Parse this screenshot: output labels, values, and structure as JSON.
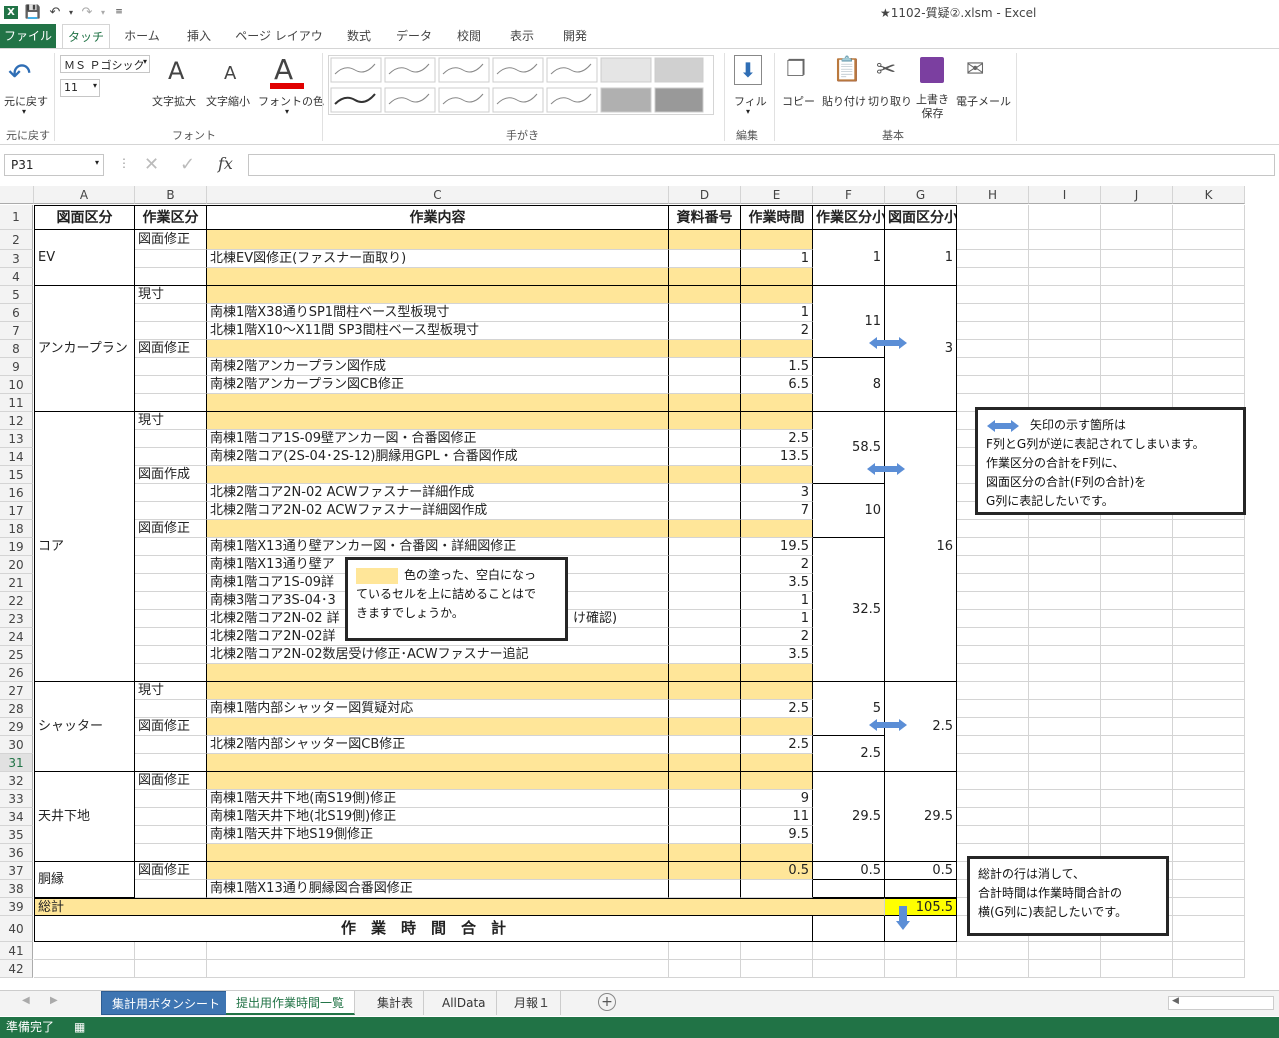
{
  "window": {
    "title": "★1102-質疑②.xlsm - Excel"
  },
  "ribbon": {
    "tabs": [
      "ファイル",
      "タッチ",
      "ホーム",
      "挿入",
      "ページ レイアウト",
      "数式",
      "データ",
      "校閲",
      "表示",
      "開発"
    ],
    "undo_label": "元に戻す",
    "undo_group": "元に戻す",
    "font_name": "ＭＳ Ｐゴシック",
    "font_size": "11",
    "grow_label": "文字拡大",
    "shrink_label": "文字縮小",
    "fontcolor_label": "フォントの色",
    "font_group": "フォント",
    "ink_group": "手がき",
    "fill_label": "フィル",
    "edit_group": "編集",
    "copy_label": "コピー",
    "paste_label": "貼り付け",
    "cut_label": "切り取り",
    "save_label": "上書き\n保存",
    "email_label": "電子メール",
    "basic_group": "基本",
    "accent": "#217346"
  },
  "formula_bar": {
    "namebox": "P31",
    "fx": "fx",
    "value": ""
  },
  "columns": [
    "A",
    "B",
    "C",
    "D",
    "E",
    "F",
    "G",
    "H",
    "I",
    "J",
    "K"
  ],
  "rows": [
    "1",
    "2",
    "3",
    "4",
    "5",
    "6",
    "7",
    "8",
    "9",
    "10",
    "11",
    "12",
    "13",
    "14",
    "15",
    "16",
    "17",
    "18",
    "19",
    "20",
    "21",
    "22",
    "23",
    "24",
    "25",
    "26",
    "27",
    "28",
    "29",
    "30",
    "31",
    "32",
    "33",
    "34",
    "35",
    "36",
    "37",
    "38",
    "39",
    "40",
    "41",
    "42"
  ],
  "sheet": {
    "headers": {
      "a": "図面区分",
      "b": "作業区分",
      "c": "作業内容",
      "d": "資料番号",
      "e": "作業時間",
      "f": "作業区分小計",
      "g": "図面区分小計"
    },
    "labels": {
      "ev": "EV",
      "anchor": "アンカープラン",
      "core": "コア",
      "shutter": "シャッター",
      "ceiling": "天井下地",
      "dobuchi": "胴縁",
      "total": "総計",
      "total_hours": "作　業　時　間　合　計"
    },
    "cells": {
      "b2": "図面修正",
      "c3": "北棟EV図修正(ファスナー面取り)",
      "e3": "1",
      "f3": "1",
      "g3": "1",
      "b5": "現寸",
      "c6": "南棟1階X38通りSP1間柱ベース型板現寸",
      "e6": "1",
      "c7": "北棟1階X10～X11間 SP3間柱ベース型板現寸",
      "e7": "2",
      "f7": "11",
      "b8": "図面修正",
      "g8": "3",
      "c9": "南棟2階アンカープラン図作成",
      "e9": "1.5",
      "c10": "南棟2階アンカープラン図CB修正",
      "e10": "6.5",
      "f10": "8",
      "b12": "現寸",
      "c13": "南棟1階コア1S-09壁アンカー図・合番図修正",
      "e13": "2.5",
      "c14": "南棟2階コア(2S-04･2S-12)胴縁用GPL・合番図作成",
      "e14": "13.5",
      "f14": "58.5",
      "b15": "図面作成",
      "c16": "北棟2階コア2N-02 ACWファスナー詳細作成",
      "e16": "3",
      "c17": "北棟2階コア2N-02 ACWファスナー詳細図作成",
      "e17": "7",
      "f17": "10",
      "b18": "図面修正",
      "c19": "南棟1階X13通り壁アンカー図・合番図・詳細図修正",
      "e19": "19.5",
      "g19": "16",
      "c20": "南棟1階X13通り壁ア",
      "e20": "2",
      "c21": "南棟1階コア1S-09詳",
      "e21": "3.5",
      "c22": "南棟3階コア3S-04･3",
      "e22": "1",
      "f22": "32.5",
      "c23": "北棟2階コア2N-02 詳",
      "c23b": "け確認)",
      "e23": "1",
      "c24": "北棟2階コア2N-02詳",
      "e24": "2",
      "c25": "北棟2階コア2N-02数居受け修正･ACWファスナー追記",
      "e25": "3.5",
      "b27": "現寸",
      "c28": "南棟1階内部シャッター図質疑対応",
      "e28": "2.5",
      "f28": "5",
      "b29": "図面修正",
      "g29": "2.5",
      "c30": "北棟2階内部シャッター図CB修正",
      "e30": "2.5",
      "f30": "2.5",
      "b32": "図面修正",
      "c33": "南棟1階天井下地(南S19側)修正",
      "e33": "9",
      "c34": "南棟1階天井下地(北S19側)修正",
      "e34": "11",
      "f34": "29.5",
      "g34": "29.5",
      "c35": "南棟1階天井下地S19側修正",
      "e35": "9.5",
      "b37": "図面修正",
      "e37": "0.5",
      "f37": "0.5",
      "g37": "0.5",
      "c38": "南棟1階X13通り胴縁図合番図修正",
      "g39": "105.5"
    }
  },
  "notes": {
    "arrow": {
      "line1": "矢印の示す箇所は",
      "line2": "F列とG列が逆に表記されてしまいます。",
      "line3": "作業区分の合計をF列に、",
      "line4": "図面区分の合計(F列の合計)を",
      "line5": "G列に表記したいです。"
    },
    "yellow": {
      "line1": "色の塗った、空白になっ",
      "line2": "ているセルを上に詰めることはで",
      "line3": "きますでしょうか。"
    },
    "total": {
      "line1": "総計の行は消して、",
      "line2": "合計時間は作業時間合計の",
      "line3": "横(G列に)表記したいです。"
    }
  },
  "sheet_tabs": [
    "集計用ボタンシート",
    "提出用作業時間一覧",
    "集計表",
    "AllData",
    "月報１"
  ],
  "status": {
    "text": "準備完了"
  }
}
